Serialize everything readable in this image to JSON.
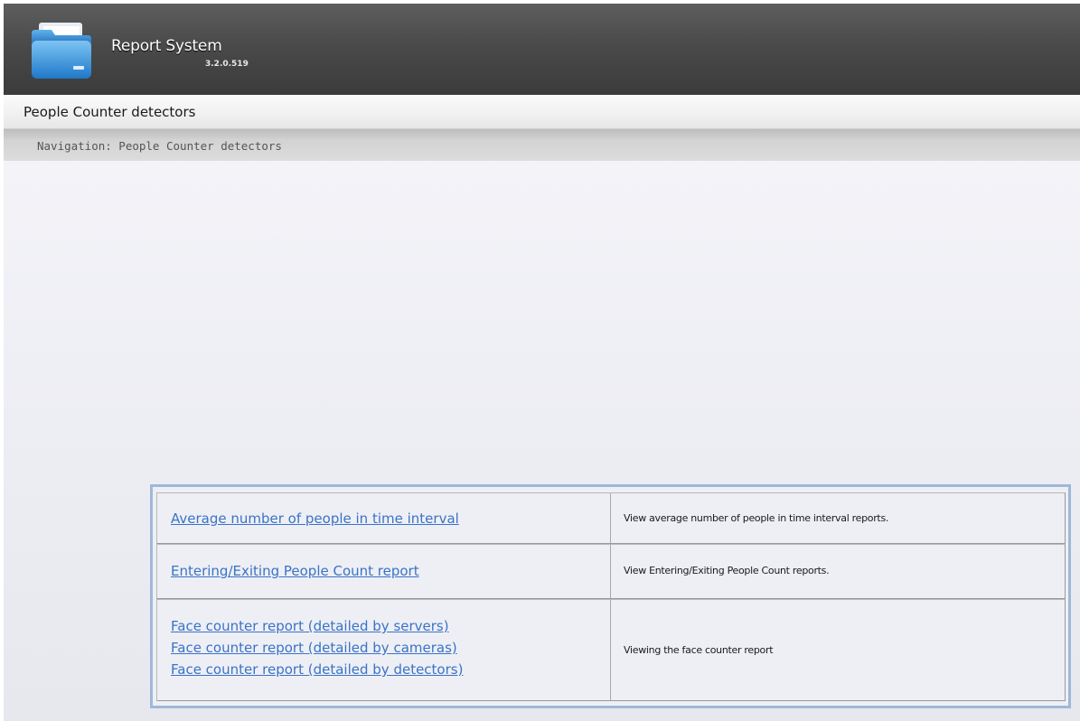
{
  "app": {
    "title": "Report System",
    "version": "3.2.0.519",
    "logo_icon": "folder-icon"
  },
  "page": {
    "title": "People Counter detectors",
    "breadcrumb": "Navigation: People Counter detectors"
  },
  "reports": [
    {
      "links": [
        "Average number of people in time interval"
      ],
      "description": "View average number of people in time interval reports."
    },
    {
      "links": [
        "Entering/Exiting People Count report"
      ],
      "description": "View Entering/Exiting People Count reports."
    },
    {
      "links": [
        "Face counter report (detailed by servers)",
        "Face counter report (detailed by cameras)",
        "Face counter report (detailed by detectors)"
      ],
      "description": "Viewing the face counter report"
    }
  ],
  "colors": {
    "link": "#3a73c6",
    "table_border": "#9fb8d8",
    "header_bg": "#4a4a4a"
  }
}
